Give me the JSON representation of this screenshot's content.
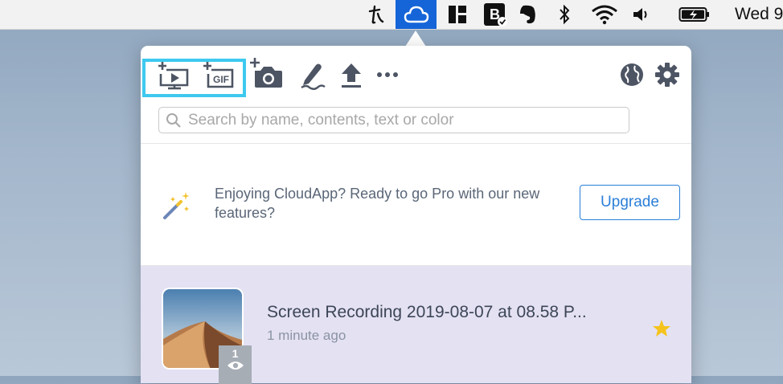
{
  "menubar": {
    "icons": [
      "typora-icon",
      "cloudapp-icon",
      "grid-app-icon",
      "bartender-icon",
      "evernote-icon",
      "bluetooth-icon",
      "wifi-icon",
      "volume-icon",
      "battery-icon"
    ],
    "clock": "Wed 9",
    "active_color": "#1565d8"
  },
  "toolbar": {
    "left": [
      "record-video-icon",
      "record-gif-icon",
      "screenshot-icon",
      "annotate-icon",
      "upload-icon",
      "more-icon"
    ],
    "right": [
      "globe-icon",
      "settings-gear-icon"
    ],
    "gif_label": "GIF",
    "highlight_color": "#3ec9ef"
  },
  "search": {
    "placeholder": "Search by name, contents, text or color",
    "value": ""
  },
  "promo": {
    "text": "Enjoying CloudApp? Ready to go Pro with our new features?",
    "button": "Upgrade",
    "accent": "#2b7fd8"
  },
  "items": [
    {
      "title": "Screen Recording 2019-08-07 at 08.58 P...",
      "time": "1 minute ago",
      "views": "1",
      "starred": true,
      "row_color": "#e4e1f3"
    }
  ]
}
